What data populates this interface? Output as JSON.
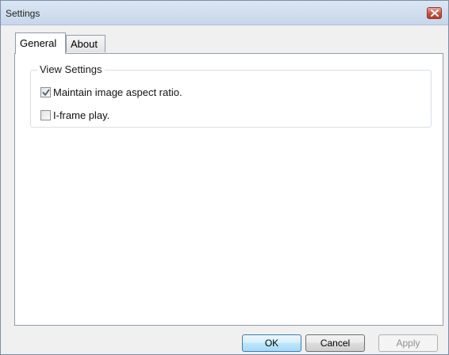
{
  "window": {
    "title": "Settings"
  },
  "tabs": [
    {
      "label": "General",
      "active": true
    },
    {
      "label": "About",
      "active": false
    }
  ],
  "view_settings": {
    "legend": "View Settings",
    "options": [
      {
        "label": "Maintain image aspect ratio.",
        "checked": true
      },
      {
        "label": "I-frame play.",
        "checked": false
      }
    ]
  },
  "buttons": {
    "ok": "OK",
    "cancel": "Cancel",
    "apply": "Apply",
    "apply_enabled": false
  },
  "icons": {
    "close": "close-icon",
    "check": "checkmark-icon"
  },
  "colors": {
    "titlebar": "#c7d6ea",
    "close_button": "#c8503d",
    "ok_border": "#3c7fb1",
    "disabled_text": "#8f8f8f"
  }
}
